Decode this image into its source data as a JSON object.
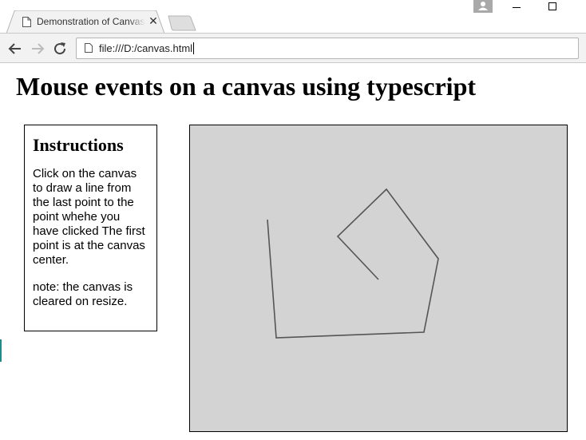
{
  "browser": {
    "tab_title": "Demonstration of Canvas",
    "tab_close": "✕",
    "url": "file:///D:/canvas.html"
  },
  "icons": {
    "tab_page": "document-icon",
    "back": "arrow-left-icon",
    "forward": "arrow-right-icon",
    "reload": "reload-icon",
    "address_page": "document-icon",
    "user": "user-icon"
  },
  "page": {
    "heading": "Mouse events on a canvas using typescript",
    "instructions": {
      "title": "Instructions",
      "paragraphs": [
        "Click on the canvas to draw a line from the last point to the point whehe you have clicked The first point is at the canvas center.",
        "note: the canvas is cleared on resize."
      ]
    }
  },
  "canvas": {
    "background": "#d3d3d3",
    "stroke": "#555555"
  }
}
